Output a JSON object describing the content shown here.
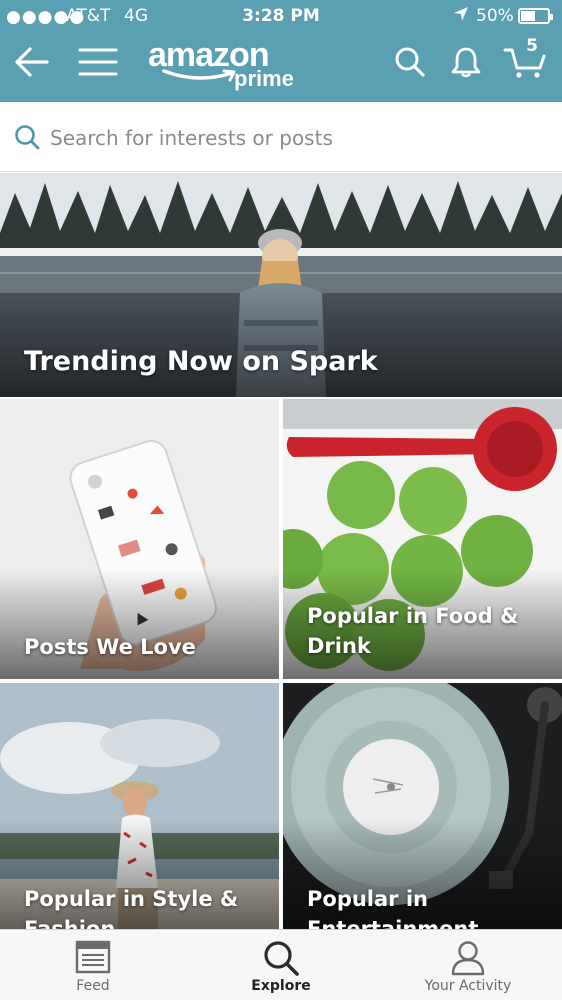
{
  "status_bar": {
    "signal": "●●●●●",
    "carrier": "AT&T",
    "network": "4G",
    "time": "3:28 PM",
    "battery_pct": "50%",
    "battery_level": 0.5
  },
  "header": {
    "logo_word1": "amazon",
    "logo_word2": "prime",
    "cart_count": "5",
    "icons": [
      "back-arrow-icon",
      "hamburger-menu-icon",
      "search-icon",
      "bell-icon",
      "cart-icon"
    ]
  },
  "search": {
    "placeholder": "Search for interests or posts",
    "value": ""
  },
  "tiles": [
    {
      "label": "Trending Now on Spark"
    },
    {
      "label": "Posts We Love"
    },
    {
      "label_line1": "Popular in Food &",
      "label_line2": "Drink"
    },
    {
      "label_line1": "Popular in Style &",
      "label_line2": "Fashion"
    },
    {
      "label_line1": "Popular in",
      "label_line2": "Entertainment"
    }
  ],
  "bottom_nav": {
    "items": [
      {
        "label": "Feed",
        "icon": "feed-icon"
      },
      {
        "label": "Explore",
        "icon": "search-icon",
        "active": true
      },
      {
        "label": "Your Activity",
        "icon": "person-icon"
      }
    ]
  },
  "colors": {
    "header_bg": "#5aa0b2",
    "accent": "#5aa0b2",
    "nav_bg": "#f7f7f7"
  }
}
